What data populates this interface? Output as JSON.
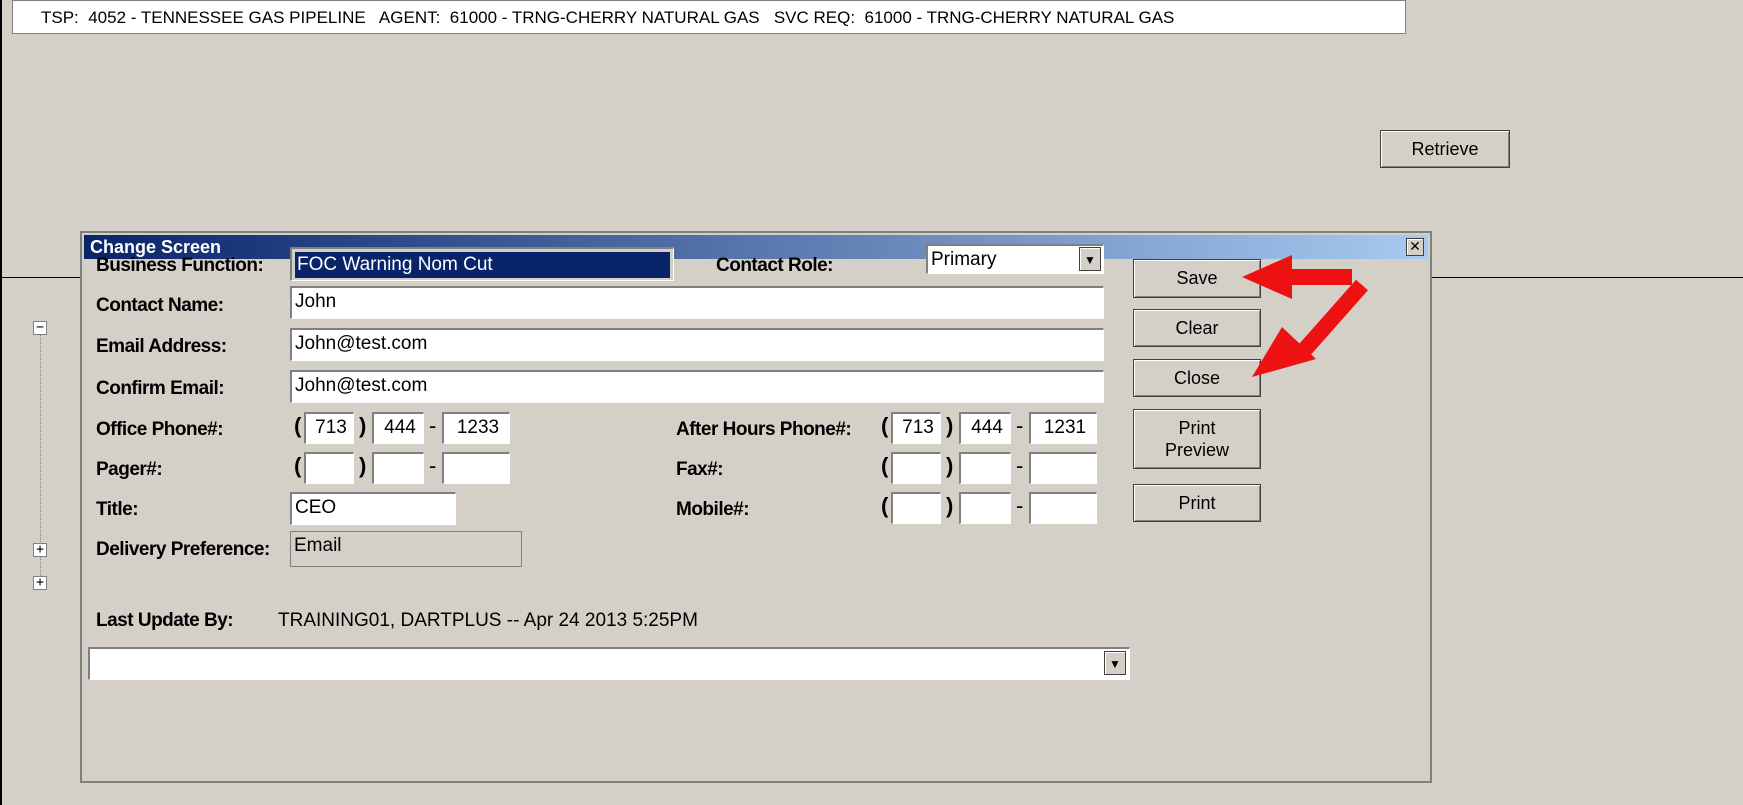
{
  "header": {
    "text": "TSP:  4052 - TENNESSEE GAS PIPELINE   AGENT:  61000 - TRNG-CHERRY NATURAL GAS   SVC REQ:  61000 - TRNG-CHERRY NATURAL GAS"
  },
  "main": {
    "retrieve_label": "Retrieve"
  },
  "tree": {
    "minus": "−",
    "plus": "+"
  },
  "dialog": {
    "title": "Change Screen",
    "close_glyph": "✕",
    "labels": {
      "business_function": "Business Function:",
      "contact_role": "Contact Role:",
      "contact_name": "Contact Name:",
      "email_address": "Email Address:",
      "confirm_email": "Confirm Email:",
      "office_phone": "Office Phone#:",
      "after_hours_phone": "After Hours Phone#:",
      "pager": "Pager#:",
      "fax": "Fax#:",
      "title": "Title:",
      "mobile": "Mobile#:",
      "delivery_preference": "Delivery Preference:",
      "last_update_by": "Last Update By:"
    },
    "values": {
      "business_function": "FOC Warning Nom Cut",
      "contact_role": "Primary",
      "contact_name": "John",
      "email_address": "John@test.com",
      "confirm_email": "John@test.com",
      "office_phone": {
        "area": "713",
        "prefix": "444",
        "line": "1233"
      },
      "after_hours_phone": {
        "area": "713",
        "prefix": "444",
        "line": "1231"
      },
      "pager": {
        "area": "",
        "prefix": "",
        "line": ""
      },
      "fax": {
        "area": "",
        "prefix": "",
        "line": ""
      },
      "mobile": {
        "area": "",
        "prefix": "",
        "line": ""
      },
      "title": "CEO",
      "delivery_preference": "Email",
      "last_update_by": "TRAINING01, DARTPLUS -- Apr 24 2013  5:25PM",
      "bottom_dropdown": ""
    },
    "punct": {
      "open": "(",
      "close": ")",
      "dash": "-"
    },
    "buttons": {
      "save": "Save",
      "clear": "Clear",
      "close": "Close",
      "print_preview": "Print Preview",
      "print": "Print"
    }
  },
  "colors": {
    "arrow": "#ee1111",
    "titlebar_start": "#0a246a",
    "titlebar_end": "#a6caf0",
    "selection": "#0a246a"
  }
}
